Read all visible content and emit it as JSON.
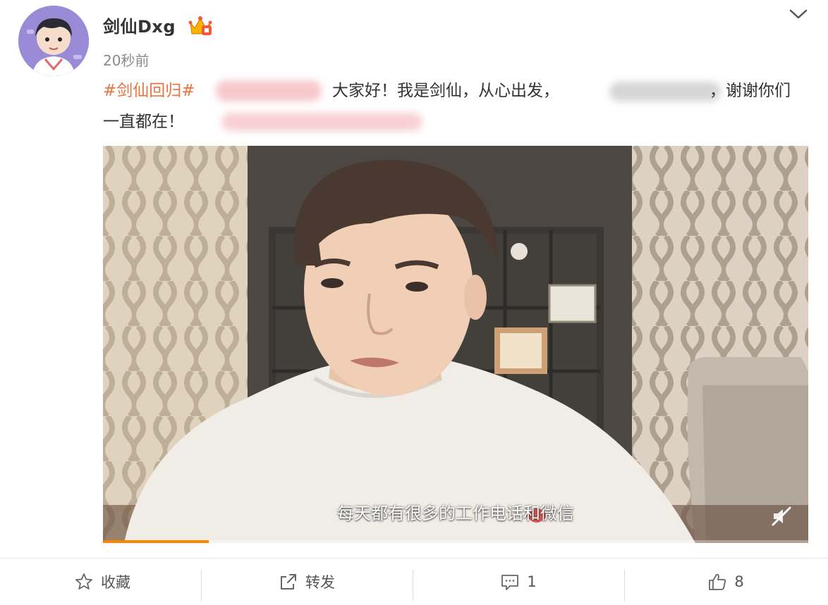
{
  "post": {
    "username": "剑仙Dxg",
    "timestamp": "20秒前",
    "topic": "#剑仙回归#",
    "text_part1": "大家好！我是剑仙，从心出发，",
    "text_part2": "，谢谢你们",
    "text_line2": "一直都在！",
    "vip_badge_icon": "crown-vip-icon",
    "menu_icon": "chevron-down-icon"
  },
  "video": {
    "subtitle": "每天都有很多的工作电话和微信",
    "progress": 0.15,
    "muted": true
  },
  "actions": {
    "favorite_label": "收藏",
    "repost_label": "转发",
    "comment_count": "1",
    "like_count": "8"
  },
  "colors": {
    "topic": "#eb7340",
    "progress": "#ff8200",
    "text": "#333333",
    "meta": "#8a8a8a"
  }
}
